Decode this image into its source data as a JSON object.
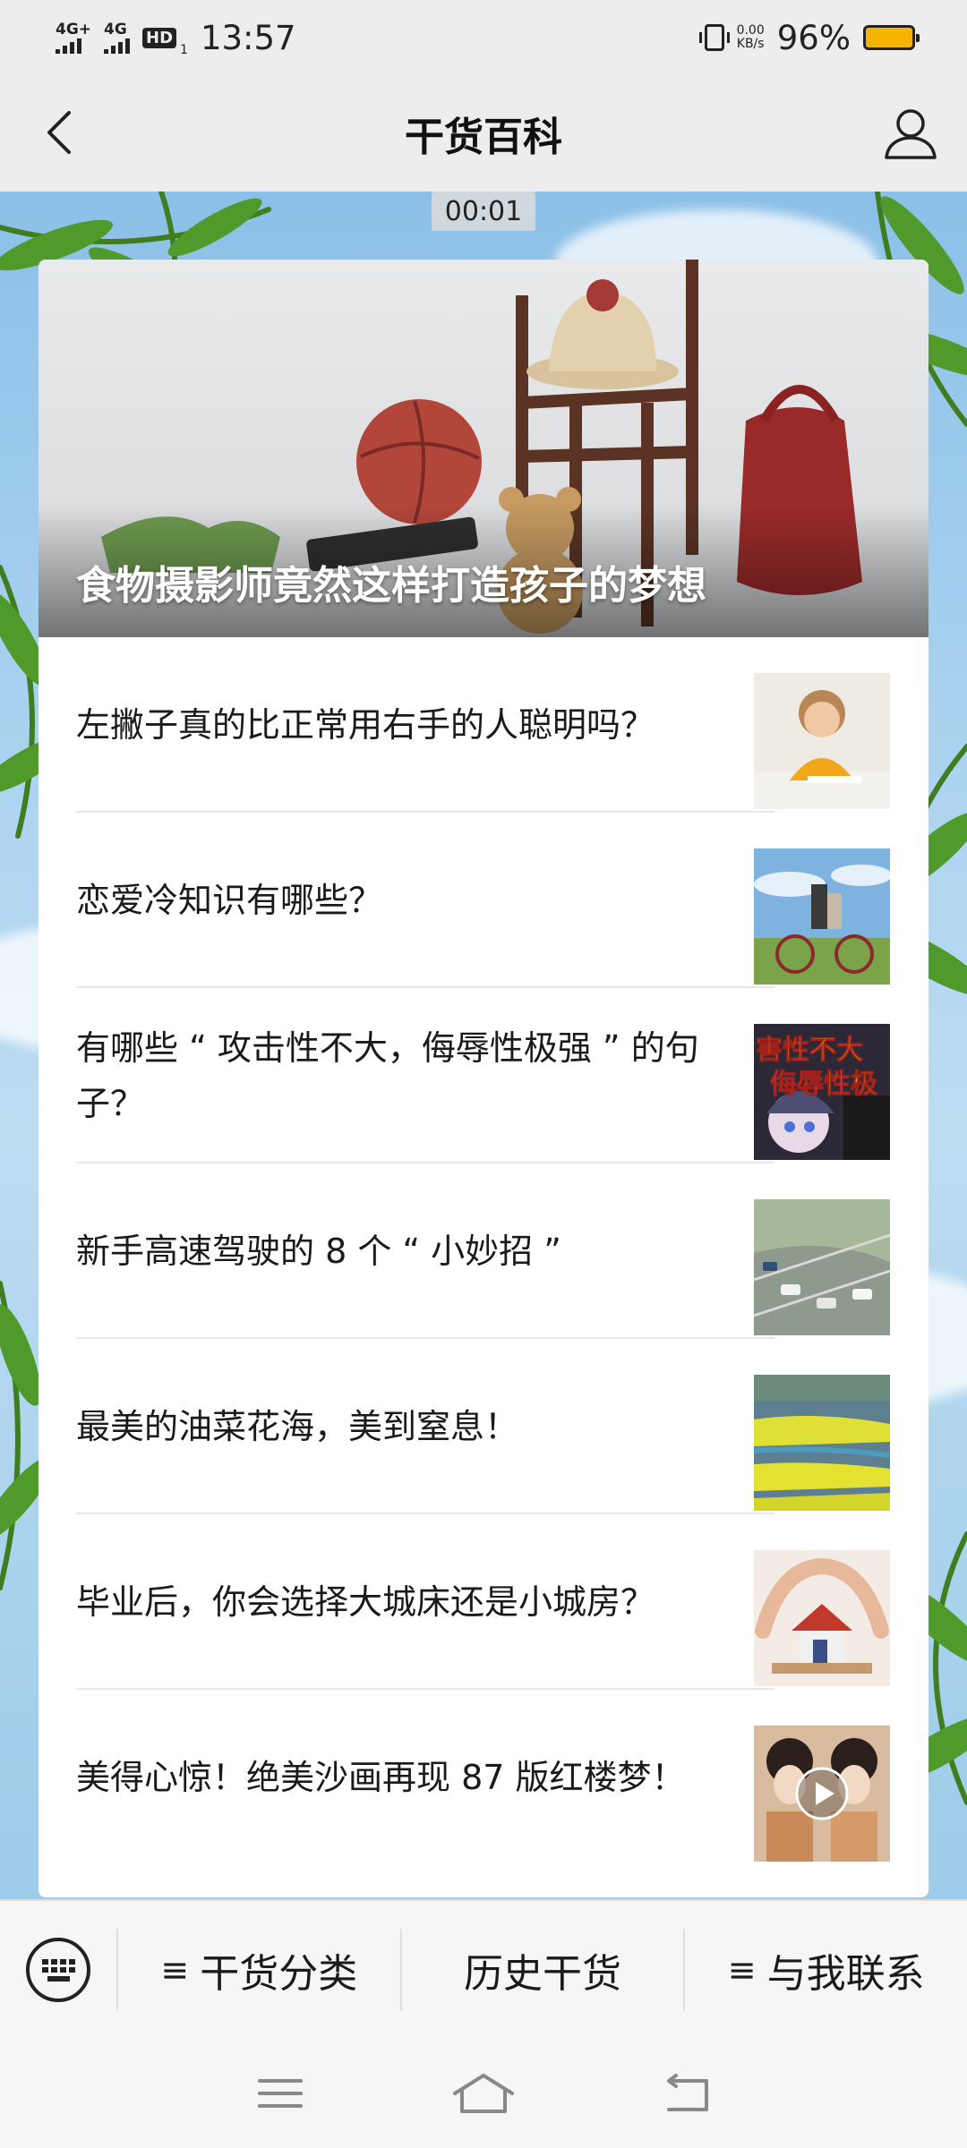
{
  "status_bar": {
    "net1": "4G+",
    "net2": "4G",
    "hd": "HD",
    "hd_sub": "1",
    "time": "13:57",
    "speed_value": "0.00",
    "speed_unit": "KB/s",
    "battery": "96%",
    "battery_level": 0.96
  },
  "header": {
    "title": "干货百科"
  },
  "timer": "00:01",
  "hero": {
    "title": "食物摄影师竟然这样打造孩子的梦想"
  },
  "articles": [
    {
      "title": "左撇子真的比正常用右手的人聪明吗？",
      "thumb": "child-writing"
    },
    {
      "title": "恋爱冷知识有哪些？",
      "thumb": "couple-bicycle"
    },
    {
      "title": "有哪些 “ 攻击性不大，侮辱性极强 ” 的句子？",
      "thumb": "anime-girl",
      "thumb_text1": "害性不大",
      "thumb_text2": "侮辱性极"
    },
    {
      "title": "新手高速驾驶的 8 个 “ 小妙招 ”",
      "thumb": "highway"
    },
    {
      "title": "最美的油菜花海，美到窒息！",
      "thumb": "rapeseed-field"
    },
    {
      "title": "毕业后，你会选择大城床还是小城房？",
      "thumb": "house-hands"
    },
    {
      "title": "美得心惊！绝美沙画再现 87 版红楼梦！",
      "thumb": "sand-painting"
    }
  ],
  "menu": {
    "item1": "干货分类",
    "item2": "历史干货",
    "item3": "与我联系"
  },
  "colors": {
    "battery": "#f5b400",
    "bar_bg": "#ededed",
    "card_bg": "#ffffff"
  }
}
